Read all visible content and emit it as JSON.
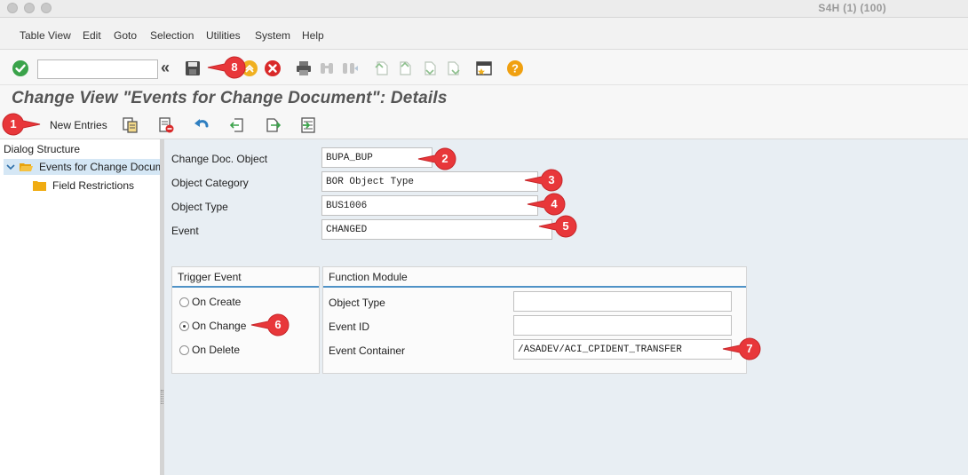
{
  "window": {
    "system_title": "S4H (1) (100)"
  },
  "menubar": {
    "items": [
      "Table View",
      "Edit",
      "Goto",
      "Selection",
      "Utilities",
      "System",
      "Help"
    ]
  },
  "toolbar": {
    "command_field_value": "",
    "nav_back_symbol": "«",
    "icons": [
      "enter-check-icon",
      "save-icon",
      "back-icon",
      "exit-icon",
      "cancel-icon",
      "print-icon",
      "find-icon",
      "find-next-icon",
      "first-page-icon",
      "previous-page-icon",
      "next-page-icon",
      "last-page-icon",
      "layout-icon",
      "help-icon"
    ]
  },
  "page": {
    "title": "Change View \"Events for Change Document\": Details"
  },
  "app_toolbar": {
    "new_entries_label": "New Entries",
    "icons": [
      "copy-as-icon",
      "delete-icon",
      "undo-icon",
      "previous-entry-icon",
      "next-entry-icon",
      "select-all-icon"
    ]
  },
  "dialog_structure": {
    "heading": "Dialog Structure",
    "items": [
      {
        "label": "Events for Change Document",
        "expanded": true,
        "selected": true
      },
      {
        "label": "Field Restrictions",
        "expanded": false,
        "selected": false
      }
    ]
  },
  "form": {
    "fields": [
      {
        "label": "Change Doc. Object",
        "value": "BUPA_BUP"
      },
      {
        "label": "Object Category",
        "value": "BOR Object Type"
      },
      {
        "label": "Object Type",
        "value": "BUS1006"
      },
      {
        "label": "Event",
        "value": "CHANGED"
      }
    ]
  },
  "trigger_event": {
    "heading": "Trigger Event",
    "options": [
      {
        "label": "On Create",
        "selected": false
      },
      {
        "label": "On Change",
        "selected": true
      },
      {
        "label": "On Delete",
        "selected": false
      }
    ]
  },
  "function_module": {
    "heading": "Function Module",
    "fields": [
      {
        "label": "Object Type",
        "value": ""
      },
      {
        "label": "Event ID",
        "value": ""
      },
      {
        "label": "Event Container",
        "value": "/ASADEV/ACI_CPIDENT_TRANSFER"
      }
    ]
  },
  "callouts": [
    "1",
    "2",
    "3",
    "4",
    "5",
    "6",
    "7",
    "8"
  ],
  "colors": {
    "callout_red": "#e8373a",
    "accent_blue": "#4f92c6",
    "selection_blue": "#d5e7f5",
    "ok_green": "#3aa34a",
    "cancel_red": "#d92a2a",
    "help_orange": "#f0a010"
  }
}
